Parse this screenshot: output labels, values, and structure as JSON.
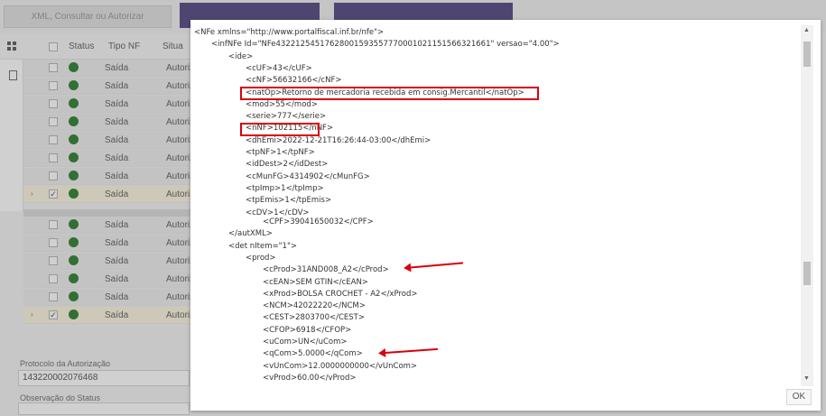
{
  "toolbar": {
    "xml_button": "XML, Consultar ou Autorizar"
  },
  "grid": {
    "headers": {
      "status": "Status",
      "tipo": "Tipo NF",
      "situacao": "Situa"
    },
    "rows_top": [
      {
        "tipo": "Saída",
        "sit": "Autoriz"
      },
      {
        "tipo": "Saída",
        "sit": "Autoriz"
      },
      {
        "tipo": "Saída",
        "sit": "Autoriz"
      },
      {
        "tipo": "Saída",
        "sit": "Autoriz"
      },
      {
        "tipo": "Saída",
        "sit": "Autoriz"
      },
      {
        "tipo": "Saída",
        "sit": "Autoriz"
      },
      {
        "tipo": "Saída",
        "sit": "Autoriz"
      },
      {
        "tipo": "Saída",
        "sit": "Autoriz"
      }
    ],
    "rows_bottom": [
      {
        "tipo": "Saída",
        "sit": "Autoriz"
      },
      {
        "tipo": "Saída",
        "sit": "Autoriz"
      },
      {
        "tipo": "Saída",
        "sit": "Autoriz"
      },
      {
        "tipo": "Saída",
        "sit": "Autoriz"
      },
      {
        "tipo": "Saída",
        "sit": "Autoriz"
      },
      {
        "tipo": "Saída",
        "sit": "Autoriz"
      }
    ]
  },
  "fields": {
    "protocolo_label": "Protocolo da Autorização",
    "protocolo_value": "143220002076468",
    "observacao_label": "Observação do Status"
  },
  "xml_top": [
    "<NFe xmlns=\"http://www.portalfiscal.inf.br/nfe\">",
    "<infNFe Id=\"NFe43221254517628001593557770001021151566321661\" versao=\"4.00\">",
    "<ide>",
    "<cUF>43</cUF>",
    "<cNF>56632166</cNF>",
    "<natOp>Retorno de mercadoria recebida em consig.Mercantil</natOp>",
    "<mod>55</mod>",
    "<serie>777</serie>",
    "<nNF>102115</nNF>",
    "<dhEmi>2022-12-21T16:26:44-03:00</dhEmi>",
    "<tpNF>1</tpNF>",
    "<idDest>2</idDest>",
    "<cMunFG>4314902</cMunFG>",
    "<tpImp>1</tpImp>",
    "<tpEmis>1</tpEmis>",
    "<cDV>1</cDV>"
  ],
  "xml_bottom": [
    "<CPF>39041650032</CPF>",
    "</autXML>",
    "<det nItem=\"1\">",
    "<prod>",
    "<cProd>31AND008_A2</cProd>",
    "<cEAN>SEM GTIN</cEAN>",
    "<xProd>BOLSA CROCHET                    - A2</xProd>",
    "<NCM>42022220</NCM>",
    "<CEST>2803700</CEST>",
    "<CFOP>6918</CFOP>",
    "<uCom>UN</uCom>",
    "<qCom>5.0000</qCom>",
    "<vUnCom>12.0000000000</vUnCom>",
    "<vProd>60.00</vProd>"
  ],
  "modal": {
    "ok_label": "OK"
  },
  "colors": {
    "highlight": "#d9000d",
    "status_green": "#0d6b12",
    "purple": "#3a2a6e"
  }
}
